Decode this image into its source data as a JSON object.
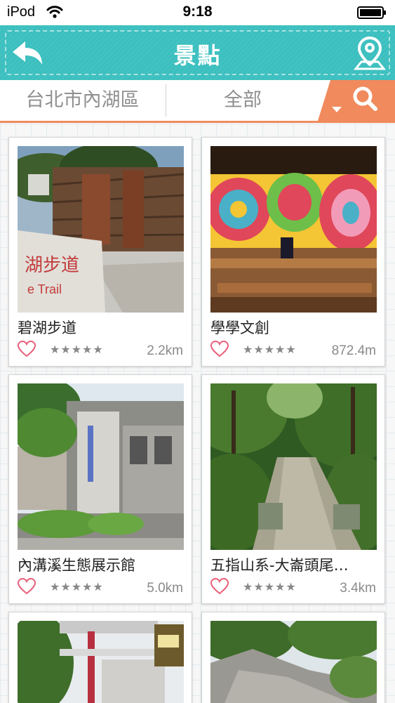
{
  "status_bar": {
    "carrier": "iPod",
    "time": "9:18"
  },
  "nav": {
    "title": "景點"
  },
  "filters": {
    "district": "台北市內湖區",
    "category": "全部"
  },
  "rating_stars": "★★★★★",
  "spots": [
    {
      "name": "碧湖步道",
      "distance": "2.2km",
      "sign_text": "湖步道",
      "sign_subtext": "e Trail"
    },
    {
      "name": "學學文創",
      "distance": "872.4m"
    },
    {
      "name": "內溝溪生態展示館",
      "distance": "5.0km"
    },
    {
      "name": "五指山系-大崙頭尾…",
      "distance": "3.4km"
    },
    {
      "name": "",
      "distance": ""
    },
    {
      "name": "",
      "distance": ""
    }
  ],
  "colors": {
    "nav": "#3bbfbf",
    "accent": "#f18a5c",
    "heart": "#e8607a"
  }
}
